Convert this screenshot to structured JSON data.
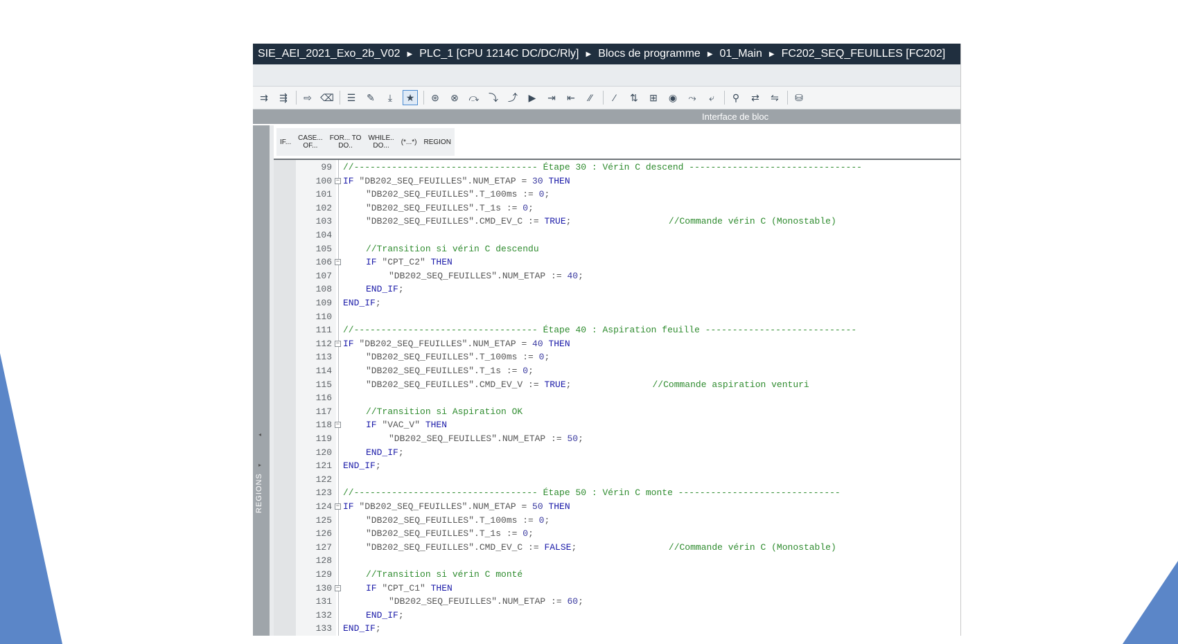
{
  "breadcrumb": {
    "items": [
      "SIE_AEI_2021_Exo_2b_V02",
      "PLC_1 [CPU 1214C DC/DC/Rly]",
      "Blocs de programme",
      "01_Main",
      "FC202_SEQ_FEUILLES [FC202]"
    ]
  },
  "toolbar": {
    "icons": [
      "insert-network-icon",
      "delete-network-icon",
      "expand-icon",
      "clear-icon",
      "list-icon",
      "edit-icon",
      "download-icon",
      "favorites-icon",
      "breakpoint-set-icon",
      "breakpoint-clear-icon",
      "step-over-icon",
      "step-into-icon",
      "step-out-icon",
      "run-icon",
      "indent-icon",
      "outdent-icon",
      "comment-icon",
      "uncomment-icon",
      "sort-icon",
      "filter-icon",
      "monitor-icon",
      "goto-icon",
      "return-icon",
      "search-icon",
      "replace-icon",
      "compare-icon",
      "db-icon"
    ],
    "interface_label": "Interface de bloc"
  },
  "snippets": [
    "IF...",
    "CASE... OF...",
    "FOR... TO DO..",
    "WHILE.. DO...",
    "(*...*)",
    "REGION"
  ],
  "regions_label": "REGIONS",
  "code_lines": [
    {
      "n": "99",
      "fold": "",
      "indent": 0,
      "parts": [
        [
          "cm",
          "//---------------------------------- Étape 30 : Vérin C descend --------------------------------"
        ]
      ]
    },
    {
      "n": "100",
      "fold": "minus",
      "indent": 0,
      "parts": [
        [
          "kw",
          "IF "
        ],
        [
          "t",
          "\"DB202_SEQ_FEUILLES\".NUM_ETAP = "
        ],
        [
          "num",
          "30"
        ],
        [
          "kw",
          " THEN"
        ]
      ]
    },
    {
      "n": "101",
      "fold": "",
      "indent": 1,
      "parts": [
        [
          "t",
          "\"DB202_SEQ_FEUILLES\".T_100ms := "
        ],
        [
          "num",
          "0"
        ],
        [
          "t",
          ";"
        ]
      ]
    },
    {
      "n": "102",
      "fold": "",
      "indent": 1,
      "parts": [
        [
          "t",
          "\"DB202_SEQ_FEUILLES\".T_1s := "
        ],
        [
          "num",
          "0"
        ],
        [
          "t",
          ";"
        ]
      ]
    },
    {
      "n": "103",
      "fold": "",
      "indent": 1,
      "parts": [
        [
          "t",
          "\"DB202_SEQ_FEUILLES\".CMD_EV_C := "
        ],
        [
          "kw",
          "TRUE"
        ],
        [
          "t",
          ";                  "
        ],
        [
          "cm",
          "//Commande vérin C (Monostable)"
        ]
      ]
    },
    {
      "n": "104",
      "fold": "",
      "indent": 0,
      "parts": []
    },
    {
      "n": "105",
      "fold": "",
      "indent": 1,
      "parts": [
        [
          "cm",
          "//Transition si vérin C descendu"
        ]
      ]
    },
    {
      "n": "106",
      "fold": "minus",
      "indent": 1,
      "parts": [
        [
          "kw",
          "IF "
        ],
        [
          "t",
          "\"CPT_C2\" "
        ],
        [
          "kw",
          "THEN"
        ]
      ]
    },
    {
      "n": "107",
      "fold": "",
      "indent": 2,
      "parts": [
        [
          "t",
          "\"DB202_SEQ_FEUILLES\".NUM_ETAP := "
        ],
        [
          "num",
          "40"
        ],
        [
          "t",
          ";"
        ]
      ]
    },
    {
      "n": "108",
      "fold": "",
      "indent": 1,
      "parts": [
        [
          "kw",
          "END_IF"
        ],
        [
          "t",
          ";"
        ]
      ]
    },
    {
      "n": "109",
      "fold": "",
      "indent": 0,
      "parts": [
        [
          "kw",
          "END_IF"
        ],
        [
          "t",
          ";"
        ]
      ]
    },
    {
      "n": "110",
      "fold": "",
      "indent": 0,
      "parts": []
    },
    {
      "n": "111",
      "fold": "",
      "indent": 0,
      "parts": [
        [
          "cm",
          "//---------------------------------- Étape 40 : Aspiration feuille ----------------------------"
        ]
      ]
    },
    {
      "n": "112",
      "fold": "minus",
      "indent": 0,
      "parts": [
        [
          "kw",
          "IF "
        ],
        [
          "t",
          "\"DB202_SEQ_FEUILLES\".NUM_ETAP = "
        ],
        [
          "num",
          "40"
        ],
        [
          "kw",
          " THEN"
        ]
      ]
    },
    {
      "n": "113",
      "fold": "",
      "indent": 1,
      "parts": [
        [
          "t",
          "\"DB202_SEQ_FEUILLES\".T_100ms := "
        ],
        [
          "num",
          "0"
        ],
        [
          "t",
          ";"
        ]
      ]
    },
    {
      "n": "114",
      "fold": "",
      "indent": 1,
      "parts": [
        [
          "t",
          "\"DB202_SEQ_FEUILLES\".T_1s := "
        ],
        [
          "num",
          "0"
        ],
        [
          "t",
          ";"
        ]
      ]
    },
    {
      "n": "115",
      "fold": "",
      "indent": 1,
      "parts": [
        [
          "t",
          "\"DB202_SEQ_FEUILLES\".CMD_EV_V := "
        ],
        [
          "kw",
          "TRUE"
        ],
        [
          "t",
          ";               "
        ],
        [
          "cm",
          "//Commande aspiration venturi"
        ]
      ]
    },
    {
      "n": "116",
      "fold": "",
      "indent": 0,
      "parts": []
    },
    {
      "n": "117",
      "fold": "",
      "indent": 1,
      "parts": [
        [
          "cm",
          "//Transition si Aspiration OK"
        ]
      ]
    },
    {
      "n": "118",
      "fold": "minus",
      "indent": 1,
      "parts": [
        [
          "kw",
          "IF "
        ],
        [
          "t",
          "\"VAC_V\" "
        ],
        [
          "kw",
          "THEN"
        ]
      ]
    },
    {
      "n": "119",
      "fold": "",
      "indent": 2,
      "parts": [
        [
          "t",
          "\"DB202_SEQ_FEUILLES\".NUM_ETAP := "
        ],
        [
          "num",
          "50"
        ],
        [
          "t",
          ";"
        ]
      ]
    },
    {
      "n": "120",
      "fold": "",
      "indent": 1,
      "parts": [
        [
          "kw",
          "END_IF"
        ],
        [
          "t",
          ";"
        ]
      ]
    },
    {
      "n": "121",
      "fold": "",
      "indent": 0,
      "parts": [
        [
          "kw",
          "END_IF"
        ],
        [
          "t",
          ";"
        ]
      ]
    },
    {
      "n": "122",
      "fold": "",
      "indent": 0,
      "parts": []
    },
    {
      "n": "123",
      "fold": "",
      "indent": 0,
      "parts": [
        [
          "cm",
          "//---------------------------------- Étape 50 : Vérin C monte ------------------------------"
        ]
      ]
    },
    {
      "n": "124",
      "fold": "minus",
      "indent": 0,
      "parts": [
        [
          "kw",
          "IF "
        ],
        [
          "t",
          "\"DB202_SEQ_FEUILLES\".NUM_ETAP = "
        ],
        [
          "num",
          "50"
        ],
        [
          "kw",
          " THEN"
        ]
      ]
    },
    {
      "n": "125",
      "fold": "",
      "indent": 1,
      "parts": [
        [
          "t",
          "\"DB202_SEQ_FEUILLES\".T_100ms := "
        ],
        [
          "num",
          "0"
        ],
        [
          "t",
          ";"
        ]
      ]
    },
    {
      "n": "126",
      "fold": "",
      "indent": 1,
      "parts": [
        [
          "t",
          "\"DB202_SEQ_FEUILLES\".T_1s := "
        ],
        [
          "num",
          "0"
        ],
        [
          "t",
          ";"
        ]
      ]
    },
    {
      "n": "127",
      "fold": "",
      "indent": 1,
      "parts": [
        [
          "t",
          "\"DB202_SEQ_FEUILLES\".CMD_EV_C := "
        ],
        [
          "kw",
          "FALSE"
        ],
        [
          "t",
          ";                 "
        ],
        [
          "cm",
          "//Commande vérin C (Monostable)"
        ]
      ]
    },
    {
      "n": "128",
      "fold": "",
      "indent": 0,
      "parts": []
    },
    {
      "n": "129",
      "fold": "",
      "indent": 1,
      "parts": [
        [
          "cm",
          "//Transition si vérin C monté"
        ]
      ]
    },
    {
      "n": "130",
      "fold": "minus",
      "indent": 1,
      "parts": [
        [
          "kw",
          "IF "
        ],
        [
          "t",
          "\"CPT_C1\" "
        ],
        [
          "kw",
          "THEN"
        ]
      ]
    },
    {
      "n": "131",
      "fold": "",
      "indent": 2,
      "parts": [
        [
          "t",
          "\"DB202_SEQ_FEUILLES\".NUM_ETAP := "
        ],
        [
          "num",
          "60"
        ],
        [
          "t",
          ";"
        ]
      ]
    },
    {
      "n": "132",
      "fold": "",
      "indent": 1,
      "parts": [
        [
          "kw",
          "END_IF"
        ],
        [
          "t",
          ";"
        ]
      ]
    },
    {
      "n": "133",
      "fold": "",
      "indent": 0,
      "parts": [
        [
          "kw",
          "END_IF"
        ],
        [
          "t",
          ";"
        ]
      ]
    }
  ],
  "colors": {
    "titlebar": "#202f3f",
    "keyword": "#1a1aa8",
    "comment": "#2e8b2e",
    "deco_blue": "#5b86c8"
  }
}
